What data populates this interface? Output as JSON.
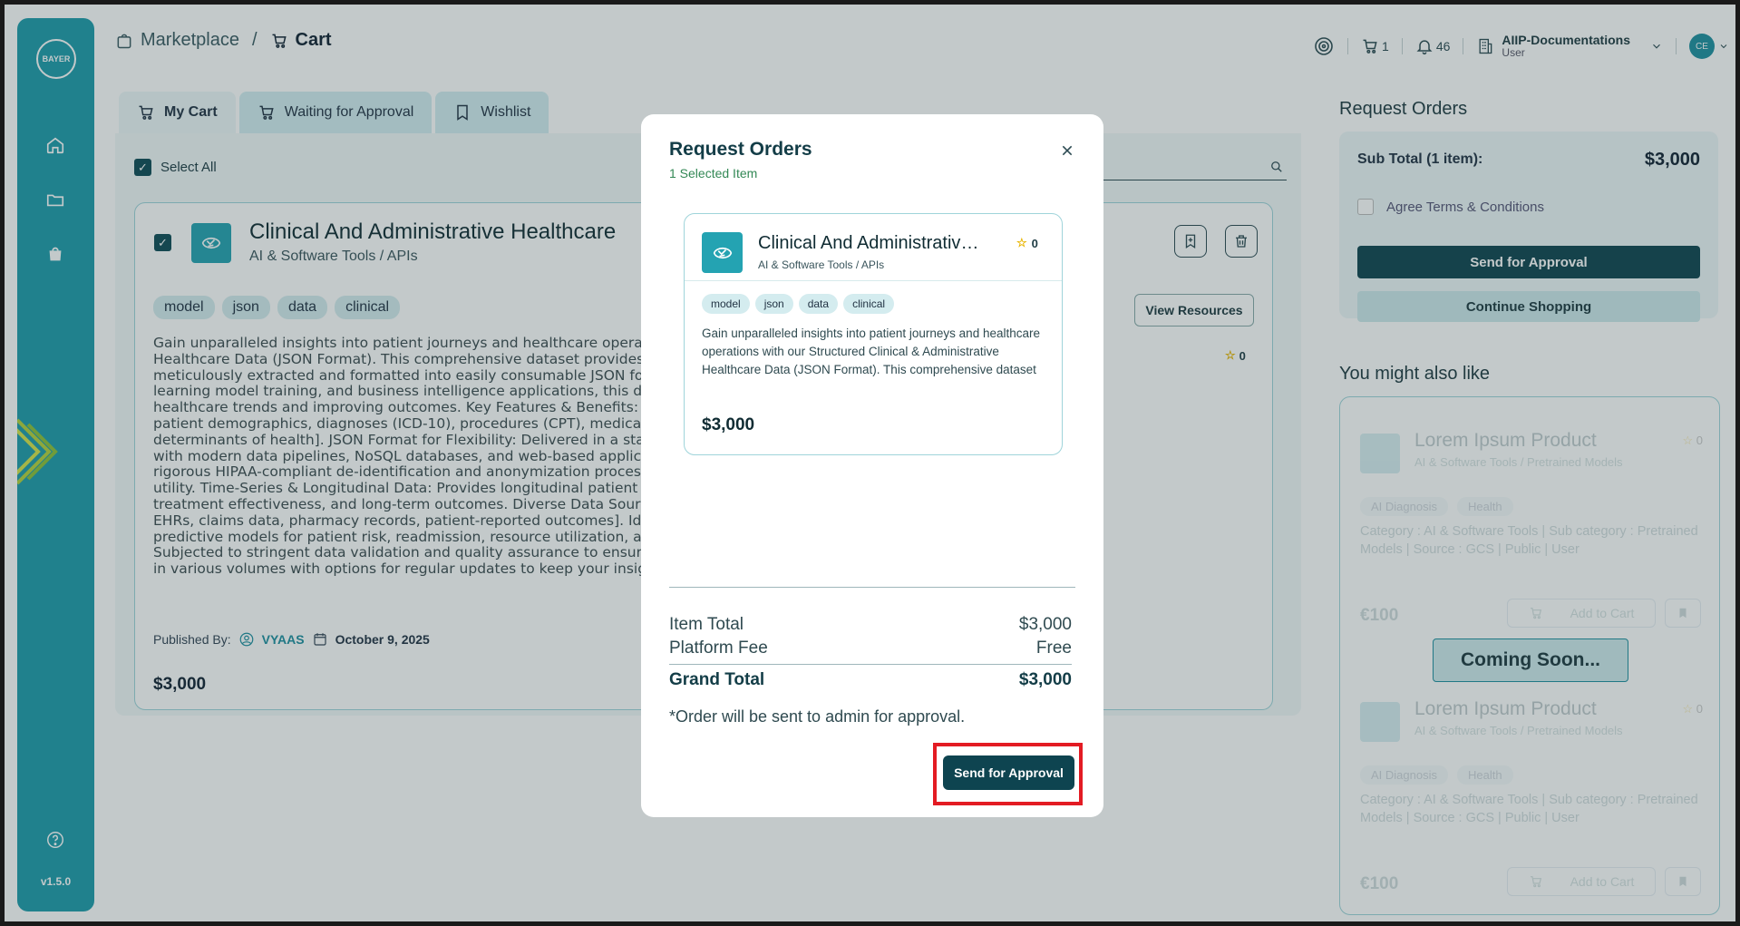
{
  "sidebar": {
    "logo_text": "BAYER",
    "version": "v1.5.0",
    "icons": [
      "home-icon",
      "folder-icon",
      "bag-icon",
      "help-icon"
    ]
  },
  "breadcrumb": {
    "marketplace": "Marketplace",
    "separator": "/",
    "current": "Cart"
  },
  "topbar": {
    "cart_count": "1",
    "notif_count": "46",
    "org_name": "AIIP-Documentations",
    "org_role": "User",
    "avatar_initials": "CE"
  },
  "tabs": [
    {
      "label": "My Cart",
      "active": true
    },
    {
      "label": "Waiting for Approval",
      "active": false
    },
    {
      "label": "Wishlist",
      "active": false
    }
  ],
  "cart": {
    "select_all": "Select All",
    "item": {
      "title": "Clinical And Administrative Healthcare",
      "category": "AI & Software Tools / APIs",
      "tags": [
        "model",
        "json",
        "data",
        "clinical"
      ],
      "description": "Gain unparalleled insights into patient journeys and healthcare operations with our Structured Clinical & Administrative Healthcare Data (JSON Format). This comprehensive dataset provides a rich, de-identified view of patient interactions, meticulously extracted and formatted into easily consumable JSON for seamless integration into analytics platforms, machine learning model training, and business intelligence applications, this dataset is an invaluable resource for understanding healthcare trends and improving outcomes. Key Features & Benefits: Rich & Comprehensive: Contains detailed records of [e.g., patient demographics, diagnoses (ICD-10), procedures (CPT), medications, lab results, encounter details, billing codes, social determinants of health]. JSON Format for Flexibility: Delivered in a standardized JSON structure, making it highly compatible with modern data pipelines, NoSQL databases, and web-based applications. Extensive Anonymization: Data has undergone rigorous HIPAA-compliant de-identification and anonymization processes to protect patient privacy while preserving analytical utility. Time-Series & Longitudinal Data: Provides longitudinal patient records, allowing for analysis of disease progression, treatment effectiveness, and long-term outcomes. Diverse Data Sources: Aggregated from a variety of sources including [e.g., EHRs, claims data, pharmacy records, patient-reported outcomes]. Ideal for Research & AI Ready: Perfect for developing predictive models for patient risk, readmission, resource utilization, and population health management. Curated & Validated: Subjected to stringent data validation and quality assurance to ensure accuracy, consistency, and reliability. Scalable: Available in various volumes with options for regular updates to keep your insights current.",
      "published_by_label": "Published By:",
      "publisher": "VYAAS",
      "date": "October 9, 2025",
      "price": "$3,000",
      "view_resources": "View Resources",
      "rating": "0"
    }
  },
  "request_panel": {
    "title": "Request Orders",
    "subtotal_label": "Sub Total (1 item):",
    "subtotal_value": "$3,000",
    "agree_label": "Agree Terms & Conditions",
    "send_btn": "Send for Approval",
    "continue_btn": "Continue Shopping"
  },
  "recommendations": {
    "title": "You might also like",
    "coming_soon": "Coming Soon...",
    "items": [
      {
        "title": "Lorem Ipsum Product",
        "sub": "AI & Software Tools / Pretrained Models",
        "rating": "0",
        "tags": [
          "AI Diagnosis",
          "Health"
        ],
        "text": "Category : AI & Software Tools | Sub category : Pretrained Models | Source : GCS | Public | User",
        "price": "€100",
        "cart_btn": "Add to Cart"
      },
      {
        "title": "Lorem Ipsum Product",
        "sub": "AI & Software Tools / Pretrained Models",
        "rating": "0",
        "tags": [
          "AI Diagnosis",
          "Health"
        ],
        "text": "Category : AI & Software Tools | Sub category : Pretrained Models | Source : GCS | Public | User",
        "price": "€100",
        "cart_btn": "Add to Cart"
      }
    ]
  },
  "modal": {
    "title": "Request Orders",
    "subtitle": "1 Selected Item",
    "card": {
      "title": "Clinical And Administrative Healthcare Data",
      "category": "AI & Software Tools / APIs",
      "rating": "0",
      "tags": [
        "model",
        "json",
        "data",
        "clinical"
      ],
      "description": "Gain unparalleled insights into patient journeys and healthcare operations with our Structured Clinical & Administrative Healthcare Data (JSON Format). This comprehensive dataset provides a rich view.",
      "price": "$3,000"
    },
    "item_total_label": "Item Total",
    "item_total_value": "$3,000",
    "platform_fee_label": "Platform Fee",
    "platform_fee_value": "Free",
    "grand_total_label": "Grand Total",
    "grand_total_value": "$3,000",
    "note": "*Order will be sent to admin for approval.",
    "send_btn": "Send for Approval"
  },
  "colors": {
    "primary": "#1e9bab",
    "dark": "#0e4450",
    "highlight": "#e31b23",
    "star": "#e8b400"
  }
}
